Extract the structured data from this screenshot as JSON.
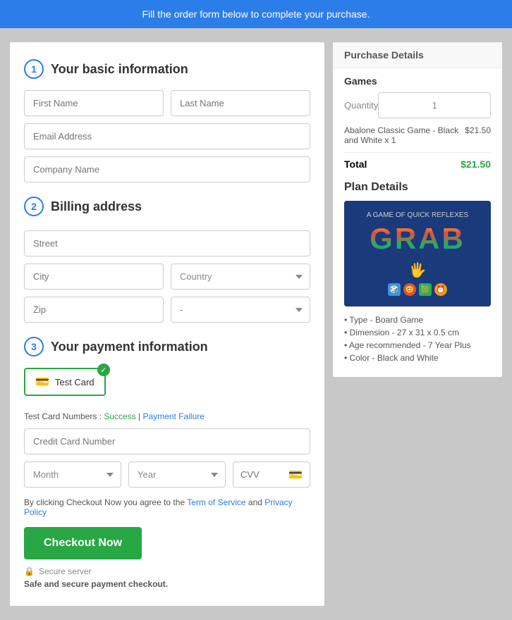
{
  "banner": {
    "text": "Fill the order form below to complete your purchase."
  },
  "sections": {
    "basic_info": {
      "step": "1",
      "title": "Your basic information"
    },
    "billing": {
      "step": "2",
      "title": "Billing address"
    },
    "payment": {
      "step": "3",
      "title": "Your payment information"
    }
  },
  "fields": {
    "first_name": {
      "placeholder": "First Name"
    },
    "last_name": {
      "placeholder": "Last Name"
    },
    "email": {
      "placeholder": "Email Address"
    },
    "company": {
      "placeholder": "Company Name"
    },
    "street": {
      "placeholder": "Street"
    },
    "city": {
      "placeholder": "City"
    },
    "country": {
      "placeholder": "Country"
    },
    "zip": {
      "placeholder": "Zip"
    },
    "state_placeholder": "-",
    "credit_card": {
      "placeholder": "Credit Card Number"
    },
    "cvv": {
      "placeholder": "CVV"
    }
  },
  "card_option": {
    "label": "Test Card"
  },
  "test_card": {
    "prefix": "Test Card Numbers : ",
    "success": "Success",
    "separator": " | ",
    "failure": "Payment Failure"
  },
  "dropdowns": {
    "month": "Month",
    "year": "Year"
  },
  "terms": {
    "prefix": "By clicking Checkout Now you agree to the ",
    "tos": "Term of Service",
    "conjunction": " and ",
    "privacy": "Privacy Policy"
  },
  "checkout_btn": "Checkout Now",
  "secure": {
    "label": "Secure server",
    "safe_text": "Safe and secure payment checkout."
  },
  "purchase_details": {
    "title": "Purchase Details",
    "section": "Games",
    "quantity_label": "Quantity",
    "quantity_value": "1",
    "item_name": "Abalone Classic Game - Black and White x 1",
    "item_price": "$21.50",
    "total_label": "Total",
    "total_value": "$21.50"
  },
  "plan_details": {
    "title": "Plan Details",
    "bullets": [
      "Type - Board Game",
      "Dimension - 27 x 31 x 0.5 cm",
      "Age recommended - 7 Year Plus",
      "Color - Black and White"
    ]
  }
}
